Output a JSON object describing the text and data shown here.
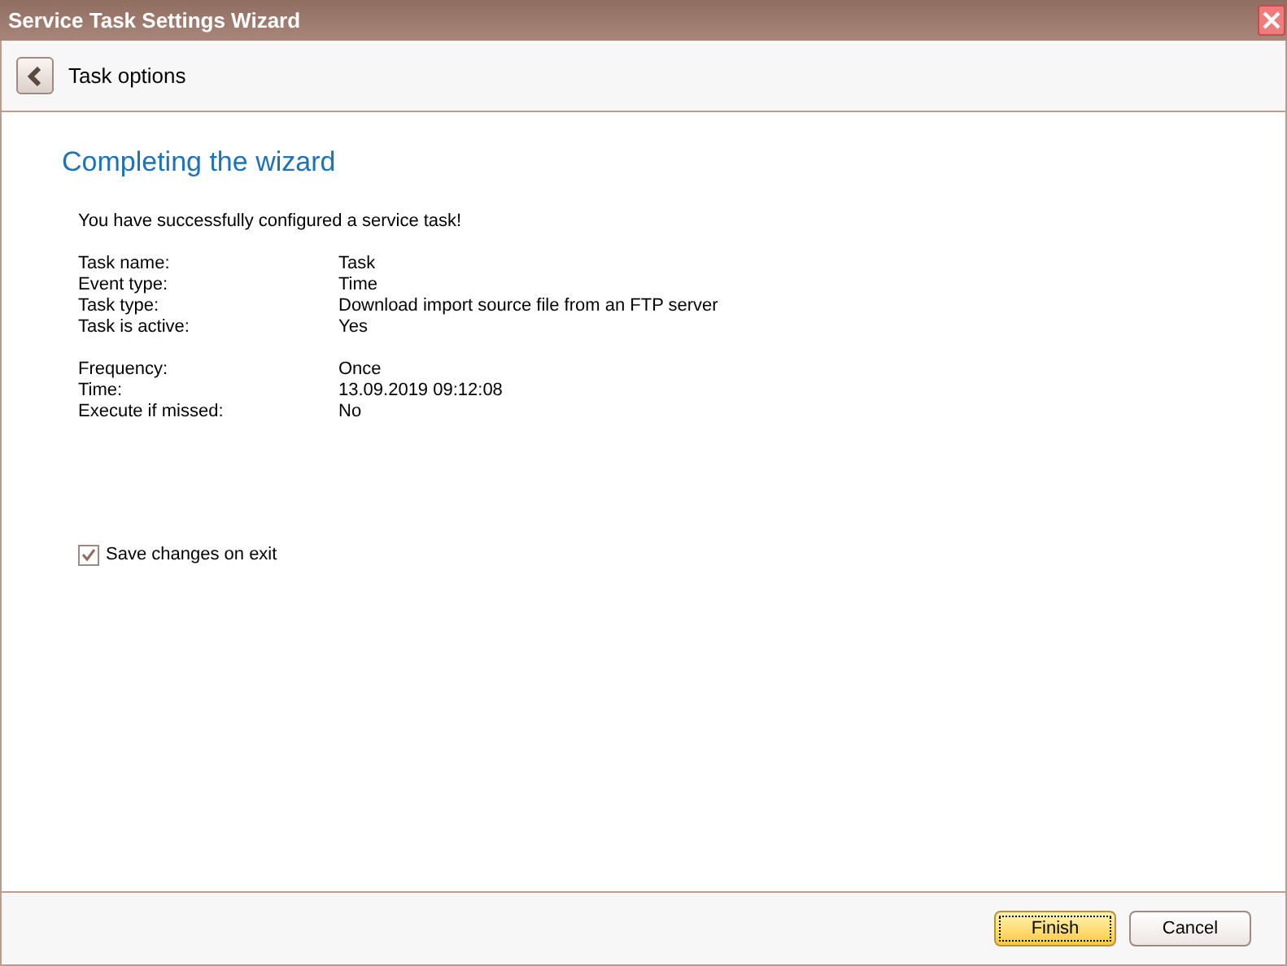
{
  "window": {
    "title": "Service Task Settings Wizard"
  },
  "header": {
    "title": "Task options"
  },
  "page": {
    "heading": "Completing the wizard",
    "message": "You have successfully configured a service task!"
  },
  "summary": [
    [
      {
        "label": "Task name:",
        "value": "Task"
      },
      {
        "label": "Event type:",
        "value": "Time"
      },
      {
        "label": "Task type:",
        "value": "Download import source file from an FTP server"
      },
      {
        "label": "Task is active:",
        "value": "Yes"
      }
    ],
    [
      {
        "label": "Frequency:",
        "value": "Once"
      },
      {
        "label": "Time:",
        "value": "13.09.2019 09:12:08"
      },
      {
        "label": "Execute if missed:",
        "value": "No"
      }
    ]
  ],
  "save_on_exit": {
    "label": "Save changes on exit",
    "checked": true
  },
  "buttons": [
    {
      "label": "Finish",
      "kind": "default"
    },
    {
      "label": "Cancel",
      "kind": "normal"
    }
  ]
}
